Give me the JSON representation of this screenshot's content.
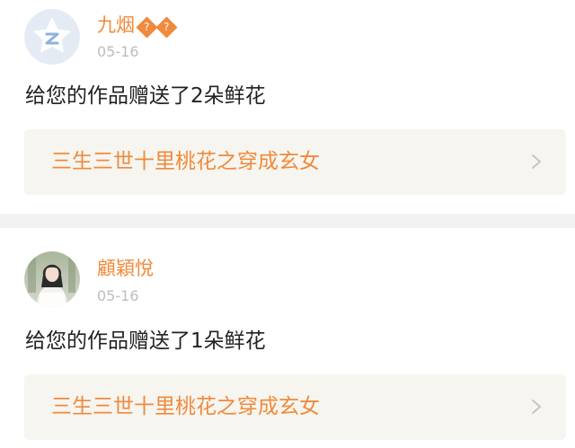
{
  "feed": {
    "items": [
      {
        "username": "九烟",
        "name_badge_glyphs": [
          "?",
          "?"
        ],
        "date": "05-16",
        "message": "给您的作品赠送了2朵鲜花",
        "work_title": "三生三世十里桃花之穿成玄女",
        "avatar_icon": "qq-default-avatar-icon",
        "chevron_icon": "chevron-right-icon"
      },
      {
        "username": "顧穎悅",
        "date": "05-16",
        "message": "给您的作品赠送了1朵鲜花",
        "work_title": "三生三世十里桃花之穿成玄女",
        "avatar_icon": "user-photo-avatar",
        "chevron_icon": "chevron-right-icon"
      }
    ]
  },
  "colors": {
    "accent": "#f08a3c",
    "date_text": "#bdbdbd",
    "message_text": "#222222",
    "link_bg": "#f6f5ef",
    "divider": "#f2f2f2",
    "chevron": "#c4c4c4"
  }
}
